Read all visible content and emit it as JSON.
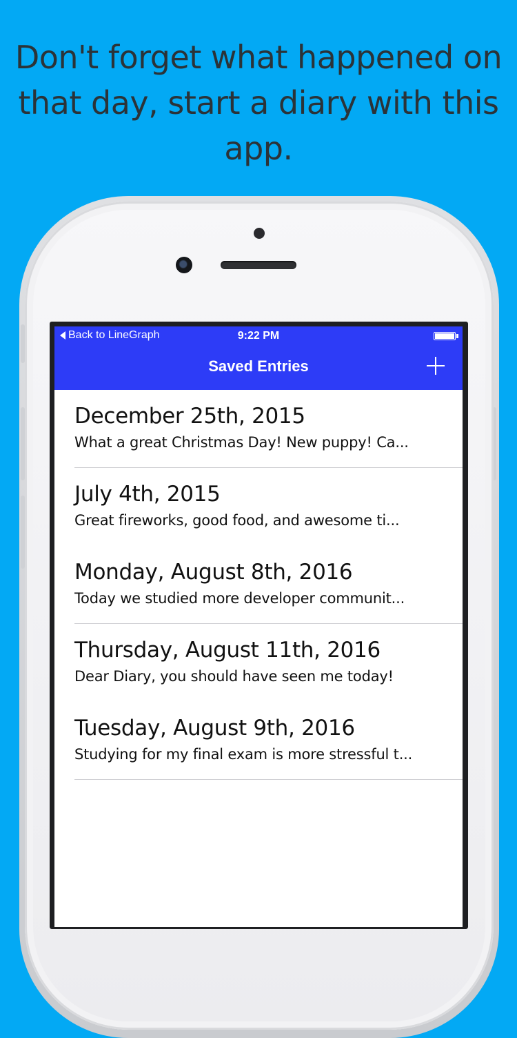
{
  "headline": "Don't forget what happened on that day, start a diary with this app.",
  "status_bar": {
    "back_label": "Back to LineGraph",
    "time": "9:22 PM"
  },
  "navbar": {
    "title": "Saved Entries",
    "add_icon": "plus-icon"
  },
  "entries": [
    {
      "title": "December 25th, 2015",
      "preview": "What a great Christmas Day! New puppy! Ca..."
    },
    {
      "title": "July 4th, 2015",
      "preview": "Great fireworks, good food, and awesome ti..."
    },
    {
      "title": "Monday, August 8th, 2016",
      "preview": "Today we studied more developer communit..."
    },
    {
      "title": "Thursday, August 11th, 2016",
      "preview": "Dear Diary, you should have seen me today!"
    },
    {
      "title": "Tuesday, August 9th, 2016",
      "preview": "Studying for my final exam is more stressful t..."
    }
  ],
  "colors": {
    "background": "#03a9f4",
    "navbar": "#2d3cf7",
    "headline_text": "#2b3338"
  }
}
